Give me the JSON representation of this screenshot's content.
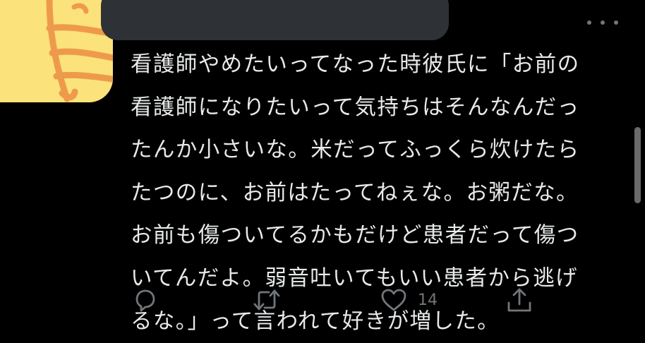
{
  "tweet": {
    "lines": [
      "看護師やめたいってなった時彼氏に「お前の",
      "看護師になりたいって気持ちはそんなんだっ",
      "たんか小さいな。米だってふっくら炊けたら",
      "たつのに、お前はたってねぇな。お粥だな。",
      "お前も傷ついてるかもだけど患者だって傷つ",
      "いてんだよ。弱音吐いてもいい患者から逃げ",
      "るな。」って言われて好きが増した。"
    ]
  },
  "actions": {
    "reply": {
      "icon": "reply-icon"
    },
    "retweet": {
      "icon": "retweet-icon"
    },
    "like": {
      "icon": "heart-icon",
      "count": "14"
    },
    "share": {
      "icon": "share-icon"
    }
  },
  "menu": {
    "icon": "more-icon"
  },
  "colors": {
    "background": "#000000",
    "text": "#e7e9ea",
    "secondary": "#71767b",
    "avatar_yellow": "#fbe27a",
    "avatar_orange": "#ee9a4d",
    "redaction": "#2e3135"
  }
}
